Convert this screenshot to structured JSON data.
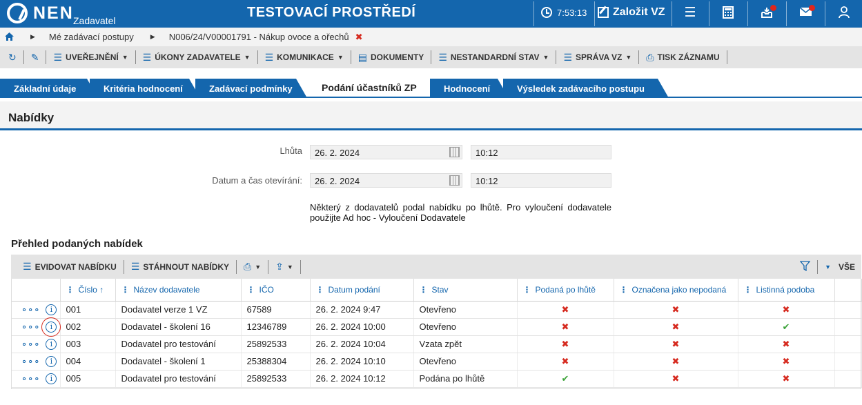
{
  "topbar": {
    "logo": "NEN",
    "logo_sub": "Zadavatel",
    "env_title": "TESTOVACÍ PROSTŘEDÍ",
    "clock": "7:53:13",
    "create_label": "Založit VZ",
    "icons": [
      "menu-icon",
      "calculator-icon",
      "inbox-icon",
      "mail-icon",
      "user-icon"
    ]
  },
  "breadcrumb": {
    "items": [
      "Mé zadávací postupy",
      "N006/24/V00001791 - Nákup ovoce a ořechů"
    ]
  },
  "toolbar": {
    "uverejneni": "UVEŘEJNĚNÍ",
    "ukony": "ÚKONY ZADAVATELE",
    "komunikace": "KOMUNIKACE",
    "dokumenty": "DOKUMENTY",
    "nestandardni": "NESTANDARDNÍ STAV",
    "sprava": "SPRÁVA VZ",
    "tisk": "TISK ZÁZNAMU"
  },
  "tabs": [
    {
      "label": "Základní údaje"
    },
    {
      "label": "Kritéria hodnocení"
    },
    {
      "label": "Zadávací podmínky"
    },
    {
      "label": "Podání účastníků ZP"
    },
    {
      "label": "Hodnocení"
    },
    {
      "label": "Výsledek zadávacího postupu"
    }
  ],
  "section": {
    "title": "Nabídky"
  },
  "form": {
    "lhuta_label": "Lhůta",
    "lhuta_date": "26. 2. 2024",
    "lhuta_time": "10:12",
    "otevirani_label": "Datum a čas otevírání:",
    "otevirani_date": "26. 2. 2024",
    "otevirani_time": "10:12",
    "note": "Některý z dodavatelů podal nabídku po lhůtě. Pro vyloučení dodavatele použijte Ad hoc - Vyloučení Dodavatele"
  },
  "grid": {
    "title": "Přehled podaných nabídek",
    "evidovat": "EVIDOVAT NABÍDKU",
    "stahnout": "STÁHNOUT NABÍDKY",
    "vse": "VŠE",
    "columns": [
      "Číslo",
      "Název dodavatele",
      "IČO",
      "Datum podání",
      "Stav",
      "Podaná po lhůtě",
      "Označena jako nepodaná",
      "Listinná podoba"
    ],
    "sort_indicator": "↑",
    "rows": [
      {
        "cislo": "001",
        "nazev": "Dodavatel verze 1 VZ",
        "ico": "67589",
        "datum": "26. 2. 2024 9:47",
        "stav": "Otevřeno",
        "po_lhute": false,
        "nepodana": false,
        "listinna": false
      },
      {
        "cislo": "002",
        "nazev": "Dodavatel - školení 16",
        "ico": "12346789",
        "datum": "26. 2. 2024 10:00",
        "stav": "Otevřeno",
        "po_lhute": false,
        "nepodana": false,
        "listinna": true
      },
      {
        "cislo": "003",
        "nazev": "Dodavatel pro testování",
        "ico": "25892533",
        "datum": "26. 2. 2024 10:04",
        "stav": "Vzata zpět",
        "po_lhute": false,
        "nepodana": false,
        "listinna": false
      },
      {
        "cislo": "004",
        "nazev": "Dodavatel - školení 1",
        "ico": "25388304",
        "datum": "26. 2. 2024 10:10",
        "stav": "Otevřeno",
        "po_lhute": false,
        "nepodana": false,
        "listinna": false
      },
      {
        "cislo": "005",
        "nazev": "Dodavatel pro testování",
        "ico": "25892533",
        "datum": "26. 2. 2024 10:12",
        "stav": "Podána po lhůtě",
        "po_lhute": true,
        "nepodana": false,
        "listinna": false
      }
    ]
  },
  "colors": {
    "brand": "#1466ad",
    "error": "#d62a1f",
    "success": "#3da33a"
  }
}
